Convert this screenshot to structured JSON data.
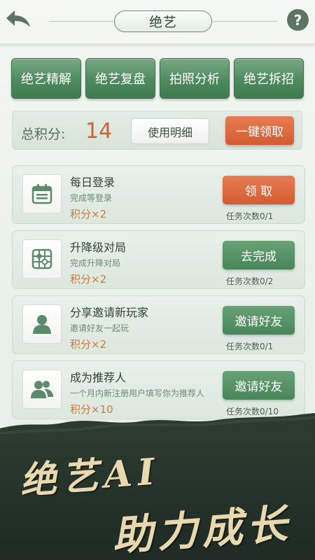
{
  "header": {
    "title": "绝艺",
    "back_icon": "back-arrow-icon",
    "help_label": "?"
  },
  "tabs": [
    {
      "label": "绝艺精解"
    },
    {
      "label": "绝艺复盘"
    },
    {
      "label": "拍照分析"
    },
    {
      "label": "绝艺拆招"
    }
  ],
  "score": {
    "label": "总积分:",
    "value": "14",
    "detail_button": "使用明细",
    "claim_all_button": "一键领取"
  },
  "tasks": [
    {
      "title": "每日登录",
      "desc": "完成等登录",
      "reward": "积分×2",
      "button": "领 取",
      "button_style": "orange",
      "count": "任务次数0/1",
      "icon": "calendar-icon"
    },
    {
      "title": "升降级对局",
      "desc": "完成升降对局",
      "reward": "积分×2",
      "button": "去完成",
      "button_style": "green",
      "count": "任务次数0/2",
      "icon": "go-board-icon"
    },
    {
      "title": "分享邀请新玩家",
      "desc": "邀请好友一起玩",
      "reward": "积分×2",
      "button": "邀请好友",
      "button_style": "green",
      "count": "任务次数0/1",
      "icon": "user-icon"
    },
    {
      "title": "成为推荐人",
      "desc": "一个月内新注册用户填写你为推荐人",
      "reward": "积分×10",
      "button": "邀请好友",
      "button_style": "green",
      "count": "任务次数0/10",
      "icon": "users-icon"
    }
  ],
  "banner": {
    "line1": "绝艺AI",
    "line2": "助力成长"
  },
  "colors": {
    "accent_green": "#4f8a5f",
    "accent_orange": "#d35c32",
    "score_orange": "#c9652f"
  }
}
